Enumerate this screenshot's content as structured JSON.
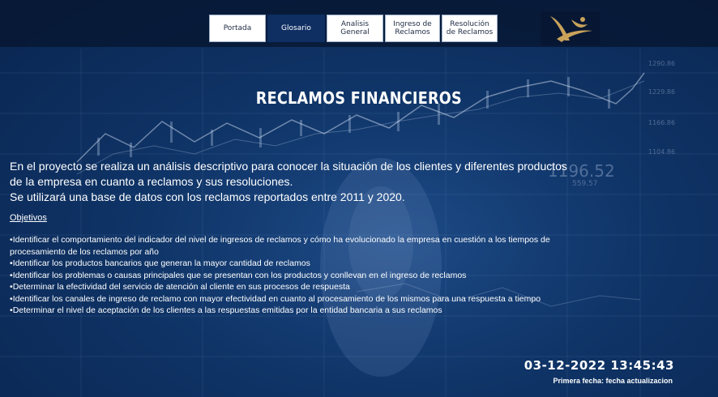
{
  "nav": {
    "items": [
      {
        "label": "Portada",
        "active": false
      },
      {
        "label": "Glosario",
        "active": true
      },
      {
        "label": "Analisis General",
        "active": false
      },
      {
        "label": "Ingreso de Reclamos",
        "active": false
      },
      {
        "label": "Resolución de Reclamos",
        "active": false
      }
    ]
  },
  "page": {
    "title": "RECLAMOS FINANCIEROS",
    "intro_line1": "En el proyecto se realiza un análisis descriptivo para conocer la situación de los clientes y diferentes productos de la empresa en cuanto a reclamos y sus resoluciones.",
    "intro_line2": "Se utilizará una base de datos con los reclamos reportados entre 2011 y 2020.",
    "objectives_heading": "Objetivos",
    "objectives": [
      "Identificar el comportamiento del indicador del nivel de ingresos de reclamos y cómo ha evolucionado la empresa en cuestión a los tiempos de procesamiento de los reclamos por año",
      "Identificar los productos bancarios que generan la mayor cantidad de reclamos",
      "Identificar los problemas o causas principales que se presentan con los productos y conllevan en el ingreso de reclamos",
      "Determinar la efectividad del servicio de atención al cliente en sus procesos de respuesta",
      "Identificar los canales de ingreso de reclamo con mayor efectividad en cuanto al procesamiento de los mismos para una respuesta a tiempo",
      "Determinar el nivel de aceptación de los clientes a las respuestas emitidas por la entidad bancaria a sus reclamos"
    ]
  },
  "footer": {
    "datetime": "03-12-2022 13:45:43",
    "note": "Primera fecha: fecha actualizacion"
  },
  "background": {
    "numbers": [
      "1196.52",
      "559.57",
      "1290.86",
      "1229.86",
      "1166.86",
      "1104.86"
    ]
  },
  "colors": {
    "nav_active": "#0f2f63",
    "logo_gold": "#c9a25a"
  },
  "icons": {
    "logo": "brand-logo-icon"
  }
}
